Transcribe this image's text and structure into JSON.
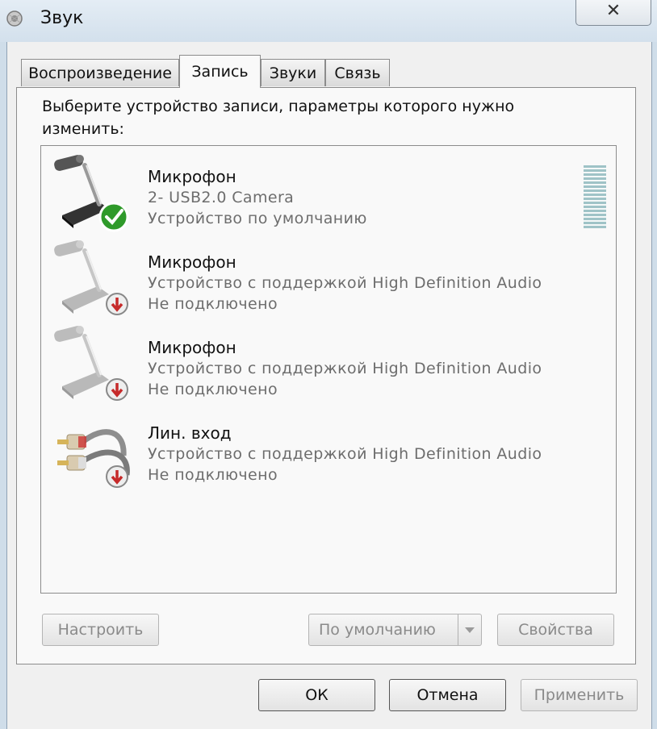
{
  "window": {
    "title": "Звук",
    "close_glyph": "✕"
  },
  "tabs": [
    {
      "label": "Воспроизведение",
      "active": false
    },
    {
      "label": "Запись",
      "active": true
    },
    {
      "label": "Звуки",
      "active": false
    },
    {
      "label": "Связь",
      "active": false
    }
  ],
  "prompt": "Выберите устройство записи, параметры которого нужно изменить:",
  "devices": [
    {
      "name": "Микрофон",
      "description": "2- USB2.0 Camera",
      "status": "Устройство по умолчанию",
      "icon": "microphone-icon",
      "badge": "default-check-icon",
      "enabled": true
    },
    {
      "name": "Микрофон",
      "description": "Устройство с поддержкой High Definition Audio",
      "status": "Не подключено",
      "icon": "microphone-icon",
      "badge": "disconnected-arrow-icon",
      "enabled": false
    },
    {
      "name": "Микрофон",
      "description": "Устройство с поддержкой High Definition Audio",
      "status": "Не подключено",
      "icon": "microphone-icon",
      "badge": "disconnected-arrow-icon",
      "enabled": false
    },
    {
      "name": "Лин. вход",
      "description": "Устройство с поддержкой High Definition Audio",
      "status": "Не подключено",
      "icon": "rca-cable-icon",
      "badge": "disconnected-arrow-icon",
      "enabled": false
    }
  ],
  "buttons": {
    "configure": "Настроить",
    "set_default": "По умолчанию",
    "properties": "Свойства",
    "ok": "ОК",
    "cancel": "Отмена",
    "apply": "Применить"
  },
  "colors": {
    "check_green": "#2f9a2a",
    "disconnected_red": "#c62a2a",
    "level_meter": "#9fc3c7"
  }
}
